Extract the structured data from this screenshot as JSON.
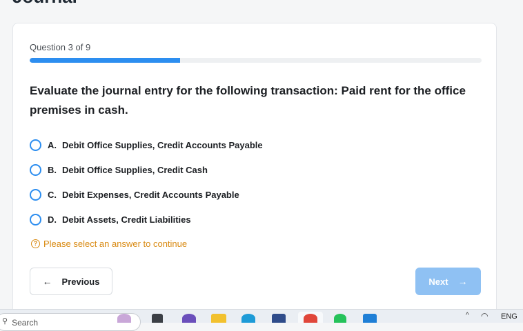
{
  "page": {
    "heading": "Journal"
  },
  "quiz": {
    "progress_label": "Question 3 of 9",
    "progress_fraction": 0.333,
    "question": "Evaluate the journal entry for the following transaction: Paid rent for the office premises in cash.",
    "options": [
      {
        "letter": "A.",
        "text": "Debit Office Supplies, Credit Accounts Payable"
      },
      {
        "letter": "B.",
        "text": "Debit Office Supplies, Credit Cash"
      },
      {
        "letter": "C.",
        "text": "Debit Expenses, Credit Accounts Payable"
      },
      {
        "letter": "D.",
        "text": "Debit Assets, Credit Liabilities"
      }
    ],
    "warning_icon": "?",
    "warning": "Please select an answer to continue",
    "previous_label": "Previous",
    "next_label": "Next",
    "prev_arrow": "←",
    "next_arrow": "→"
  },
  "taskbar": {
    "search_placeholder": "Search",
    "search_icon": "⚲",
    "language": "ENG",
    "chevron": "^",
    "wifi": "◠"
  },
  "colors": {
    "accent": "#2d8ef0",
    "next_disabled": "#8fc1f3",
    "warning": "#d98a12"
  }
}
